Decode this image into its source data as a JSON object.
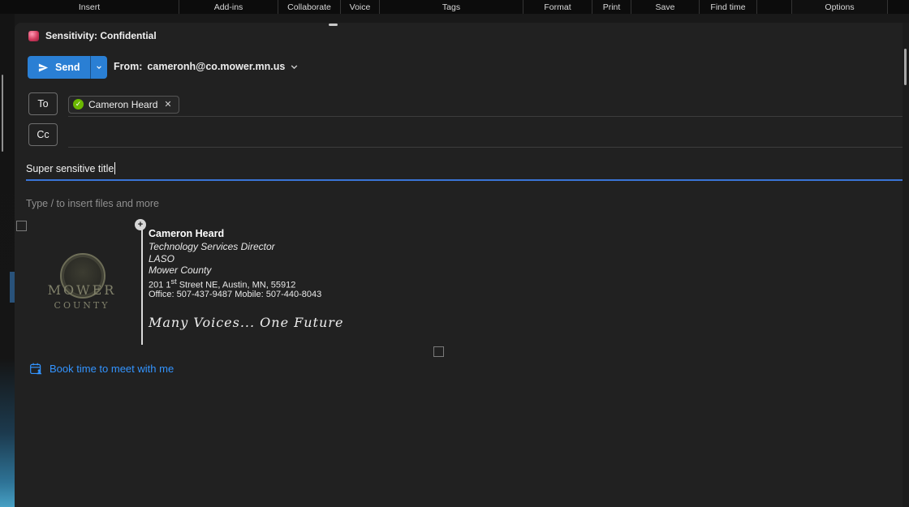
{
  "menubar": {
    "items": [
      {
        "label": "Insert"
      },
      {
        "label": "Add-ins"
      },
      {
        "label": "Collaborate"
      },
      {
        "label": "Voice"
      },
      {
        "label": "Tags"
      },
      {
        "label": "Format"
      },
      {
        "label": "Print"
      },
      {
        "label": "Save"
      },
      {
        "label": "Find time"
      },
      {
        "label": "Options"
      }
    ]
  },
  "sensitivity": {
    "label": "Sensitivity: Confidential"
  },
  "toolbar": {
    "send_label": "Send"
  },
  "from": {
    "label": "From:",
    "address": "cameronh@co.mower.mn.us"
  },
  "recipients": {
    "to_label": "To",
    "cc_label": "Cc",
    "to_chip": {
      "name": "Cameron Heard"
    }
  },
  "subject": {
    "value": "Super sensitive title"
  },
  "body": {
    "placeholder": "Type / to insert files and more"
  },
  "signature": {
    "logo_line1": "MOWER",
    "logo_line2": "COUNTY",
    "name": "Cameron Heard",
    "title": "Technology Services Director",
    "org1": "LASO",
    "org2": "Mower County",
    "address_prefix": "201 1",
    "address_sup": "st",
    "address_rest": " Street NE, Austin, MN, 55912",
    "phones": "Office: 507-437-9487 Mobile: 507-440-8043",
    "tagline": "Many Voices... One Future"
  },
  "booking": {
    "label": "Book time to meet with me"
  },
  "icons": {
    "presence_check": "✓",
    "remove": "✕",
    "plus": "+"
  },
  "colors": {
    "accent_blue": "#2a7fd4",
    "link_blue": "#3394ff",
    "presence_green": "#6bb700",
    "sensitivity_red": "#d23b5e",
    "subject_underline": "#3a74d6",
    "panel_bg": "#212121",
    "menubar_bg": "#0c0c0c"
  }
}
